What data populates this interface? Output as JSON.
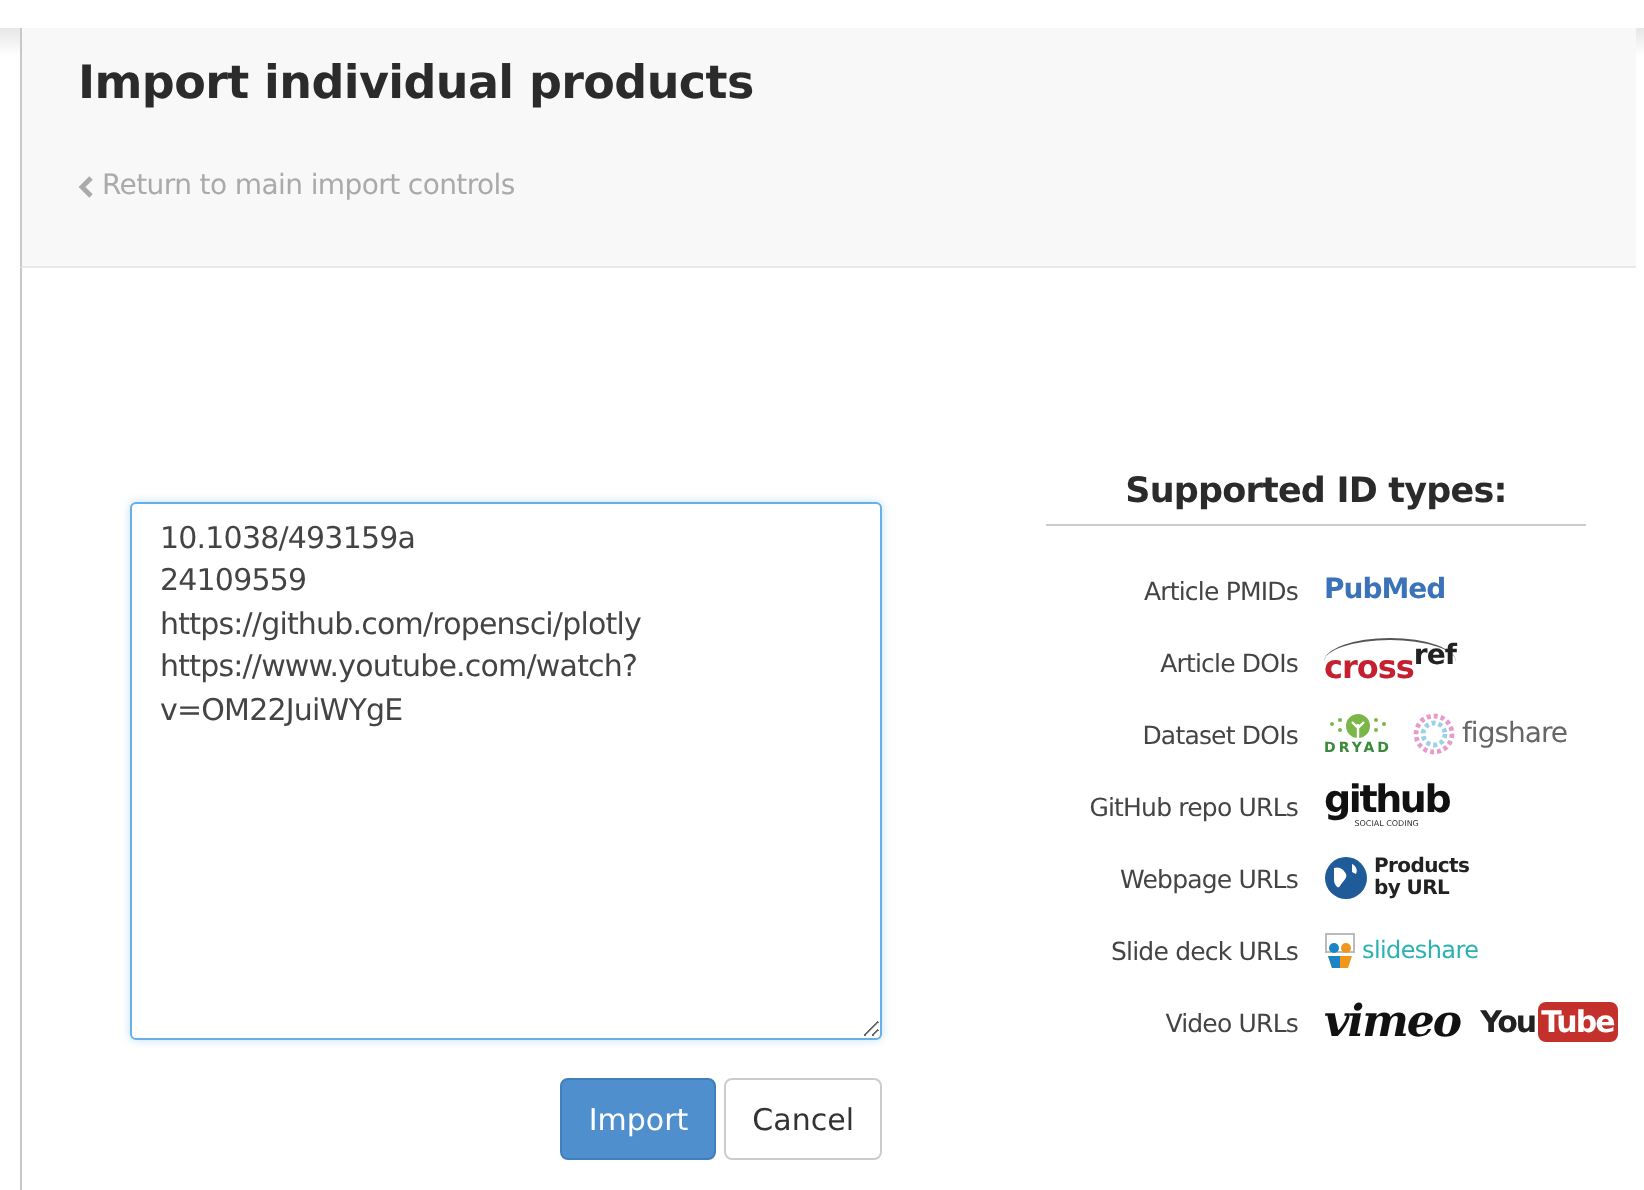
{
  "header": {
    "title": "Import individual products",
    "back_link": "Return to main import controls"
  },
  "importer": {
    "value": "10.1038/493159a\n24109559\nhttps://github.com/ropensci/plotly\nhttps://www.youtube.com/watch?v=OM22JuiWYgE",
    "buttons": [
      {
        "label": "Import",
        "kind": "primary"
      },
      {
        "label": "Cancel",
        "kind": "default"
      }
    ]
  },
  "id_types": {
    "title": "Supported ID types:",
    "rows": [
      {
        "label": "Article PMIDs",
        "logos": [
          {
            "kind": "pubmed",
            "text": "PubMed"
          }
        ]
      },
      {
        "label": "Article DOIs",
        "logos": [
          {
            "kind": "crossref",
            "text": "cross",
            "raised": "ref"
          }
        ]
      },
      {
        "label": "Dataset DOIs",
        "logos": [
          {
            "kind": "dryad",
            "text": "DRYAD"
          },
          {
            "kind": "figshare",
            "text": "figshare"
          }
        ]
      },
      {
        "label": "GitHub repo URLs",
        "logos": [
          {
            "kind": "github",
            "text": "github",
            "subtext": "SOCIAL CODING"
          }
        ]
      },
      {
        "label": "Webpage URLs",
        "logos": [
          {
            "kind": "products",
            "text": "Products by URL"
          }
        ]
      },
      {
        "label": "Slide deck URLs",
        "logos": [
          {
            "kind": "slideshare",
            "text": "slideshare"
          }
        ]
      },
      {
        "label": "Video URLs",
        "logos": [
          {
            "kind": "vimeo",
            "text": "vimeo"
          },
          {
            "kind": "youtube",
            "text": "You",
            "box": "Tube"
          }
        ]
      }
    ]
  }
}
